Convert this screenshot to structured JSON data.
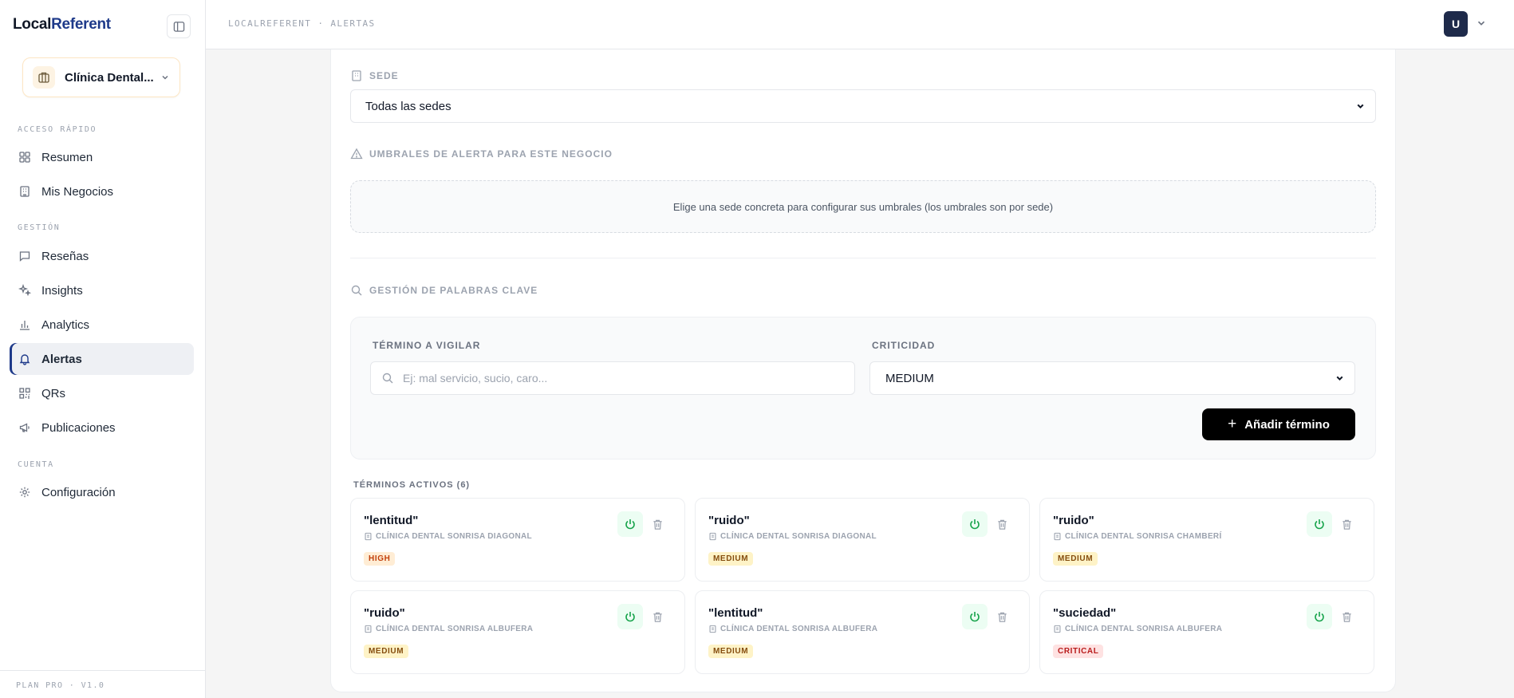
{
  "app": {
    "logo_part1": "Local",
    "logo_part2": "Referent"
  },
  "business": {
    "name": "Clínica Dental..."
  },
  "sidebar": {
    "sections": [
      "ACCESO RÁPIDO",
      "GESTIÓN",
      "CUENTA"
    ],
    "items": [
      {
        "label": "Resumen"
      },
      {
        "label": "Mis Negocios"
      },
      {
        "label": "Reseñas"
      },
      {
        "label": "Insights"
      },
      {
        "label": "Analytics"
      },
      {
        "label": "Alertas"
      },
      {
        "label": "QRs"
      },
      {
        "label": "Publicaciones"
      },
      {
        "label": "Configuración"
      }
    ],
    "footer": "PLAN PRO · V1.0"
  },
  "header": {
    "breadcrumb": "LOCALREFERENT · ALERTAS",
    "avatar_initial": "U"
  },
  "sede": {
    "title": "SEDE",
    "selected": "Todas las sedes"
  },
  "thresholds": {
    "title": "UMBRALES DE ALERTA PARA ESTE NEGOCIO",
    "empty_message": "Elige una sede concreta para configurar sus umbrales (los umbrales son por sede)"
  },
  "keywords": {
    "title": "GESTIÓN DE PALABRAS CLAVE",
    "term_label": "TÉRMINO A VIGILAR",
    "term_placeholder": "Ej: mal servicio, sucio, caro...",
    "criticality_label": "CRITICIDAD",
    "criticality_selected": "MEDIUM",
    "add_button": "Añadir término",
    "active_label": "TÉRMINOS ACTIVOS (6)",
    "terms": [
      {
        "word": "\"lentitud\"",
        "location": "CLÍNICA DENTAL SONRISA DIAGONAL",
        "level": "HIGH"
      },
      {
        "word": "\"ruido\"",
        "location": "CLÍNICA DENTAL SONRISA DIAGONAL",
        "level": "MEDIUM"
      },
      {
        "word": "\"ruido\"",
        "location": "CLÍNICA DENTAL SONRISA CHAMBERÍ",
        "level": "MEDIUM"
      },
      {
        "word": "\"ruido\"",
        "location": "CLÍNICA DENTAL SONRISA ALBUFERA",
        "level": "MEDIUM"
      },
      {
        "word": "\"lentitud\"",
        "location": "CLÍNICA DENTAL SONRISA ALBUFERA",
        "level": "MEDIUM"
      },
      {
        "word": "\"suciedad\"",
        "location": "CLÍNICA DENTAL SONRISA ALBUFERA",
        "level": "CRITICAL"
      }
    ]
  },
  "colors": {
    "brand": "#1e3a8a",
    "power_green": "#16a34a",
    "button_black": "#000000"
  }
}
